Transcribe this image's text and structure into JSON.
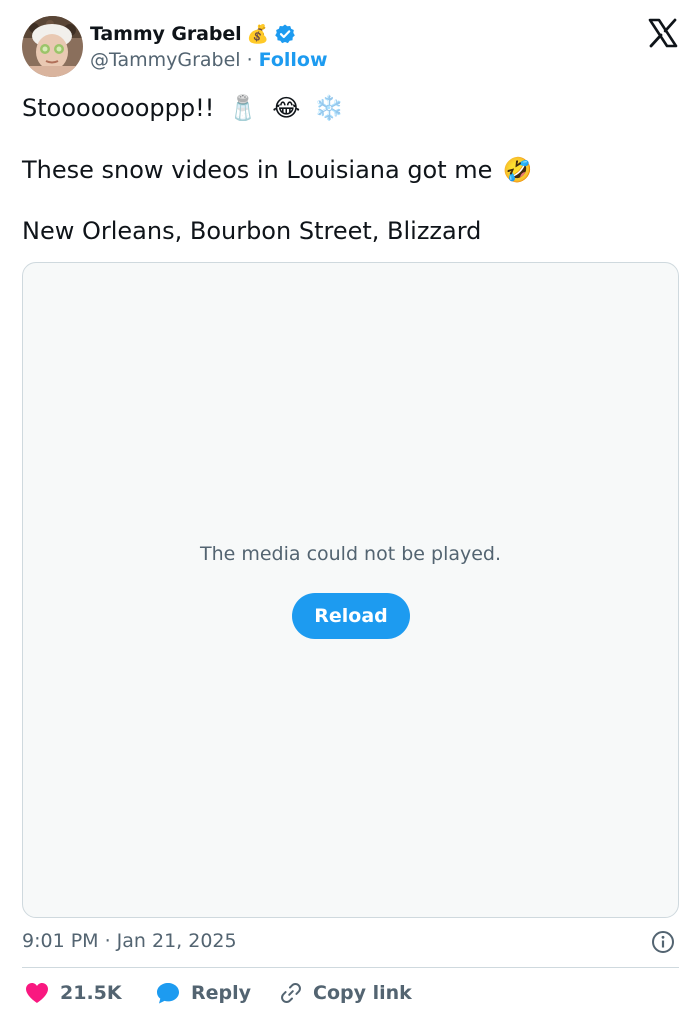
{
  "author": {
    "display_name": "Tammy Grabel",
    "handle": "@TammyGrabel",
    "separator": "·",
    "follow_label": "Follow",
    "name_emoji": "💰"
  },
  "tweet": {
    "line1": "Stoooooooppp!!",
    "line1_emojis": [
      "🧂",
      "😂",
      "❄️"
    ],
    "line2": "These snow videos in Louisiana got me",
    "line2_emoji": "🤣",
    "line3": "New Orleans, Bourbon Street, Blizzard"
  },
  "media": {
    "error_message": "The media could not be played.",
    "reload_label": "Reload"
  },
  "meta": {
    "timestamp": "9:01 PM · Jan 21, 2025"
  },
  "actions": {
    "likes_count": "21.5K",
    "reply_label": "Reply",
    "copy_link_label": "Copy link"
  },
  "colors": {
    "accent": "#1d9bf0",
    "like": "#f91880",
    "secondary_text": "#536471",
    "media_bg": "#f7f9f9",
    "border": "#cfd9de"
  }
}
